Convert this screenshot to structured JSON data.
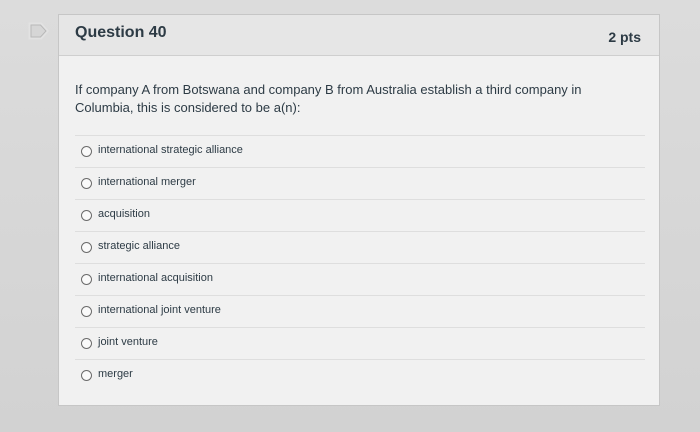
{
  "question": {
    "title": "Question 40",
    "points": "2 pts",
    "text": "If company A from Botswana and company B from Australia establish a third company in Columbia, this is considered to be a(n):"
  },
  "answers": [
    "international strategic alliance",
    "international merger",
    "acquisition",
    "strategic alliance",
    "international acquisition",
    "international joint venture",
    "joint venture",
    "merger"
  ],
  "icons": {
    "flag": "flag-question-icon"
  },
  "colors": {
    "text": "#2d3b45",
    "card": "#f1f1f1",
    "header": "#e6e6e6"
  }
}
